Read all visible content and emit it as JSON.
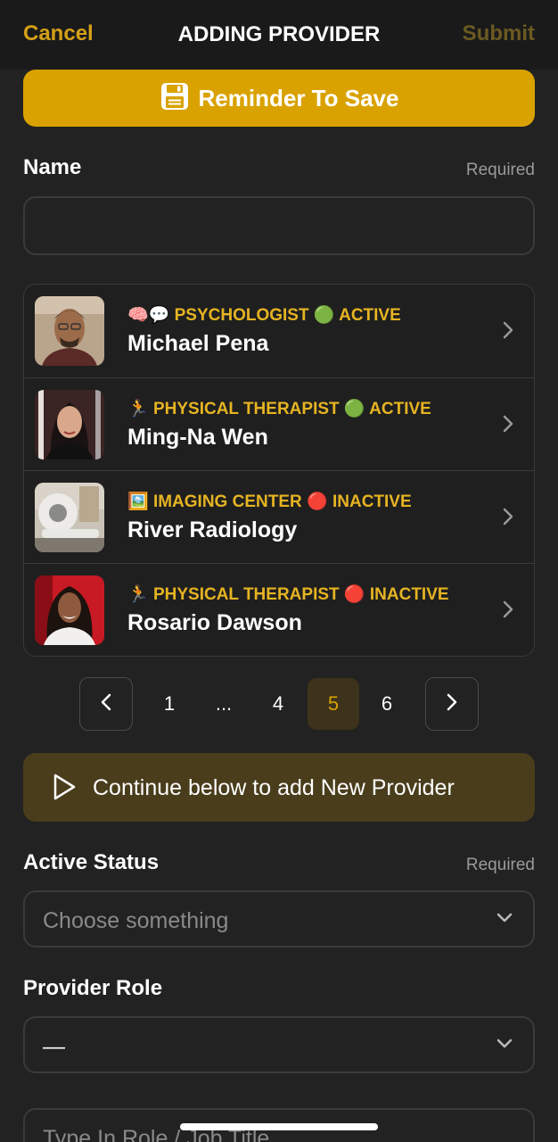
{
  "header": {
    "cancel_label": "Cancel",
    "title": "ADDING PROVIDER",
    "submit_label": "Submit"
  },
  "reminder": {
    "label": "Reminder To Save",
    "icon": "floppy-disk-icon"
  },
  "name_field": {
    "label": "Name",
    "required": "Required",
    "value": ""
  },
  "providers": [
    {
      "emoji": "🧠💬",
      "role": "PSYCHOLOGIST",
      "status_emoji": "🟢",
      "status": "ACTIVE",
      "name": "Michael Pena"
    },
    {
      "emoji": "🏃",
      "role": "PHYSICAL THERAPIST",
      "status_emoji": "🟢",
      "status": "ACTIVE",
      "name": "Ming-Na Wen"
    },
    {
      "emoji": "🖼️",
      "role": "IMAGING CENTER",
      "status_emoji": "🔴",
      "status": "INACTIVE",
      "name": "River Radiology"
    },
    {
      "emoji": "🏃",
      "role": "PHYSICAL THERAPIST",
      "status_emoji": "🔴",
      "status": "INACTIVE",
      "name": "Rosario Dawson"
    }
  ],
  "pagination": {
    "pages": [
      "1",
      "...",
      "4",
      "5",
      "6"
    ],
    "current": "5"
  },
  "continue": {
    "label": "Continue below to add New Provider"
  },
  "active_status": {
    "label": "Active Status",
    "required": "Required",
    "placeholder": "Choose something"
  },
  "provider_role": {
    "label": "Provider Role",
    "value": "—"
  },
  "role_title": {
    "placeholder": "Type In Role / Job Title"
  },
  "colors": {
    "accent": "#d9a200",
    "background": "#222222",
    "meta_text": "#e6b422"
  }
}
